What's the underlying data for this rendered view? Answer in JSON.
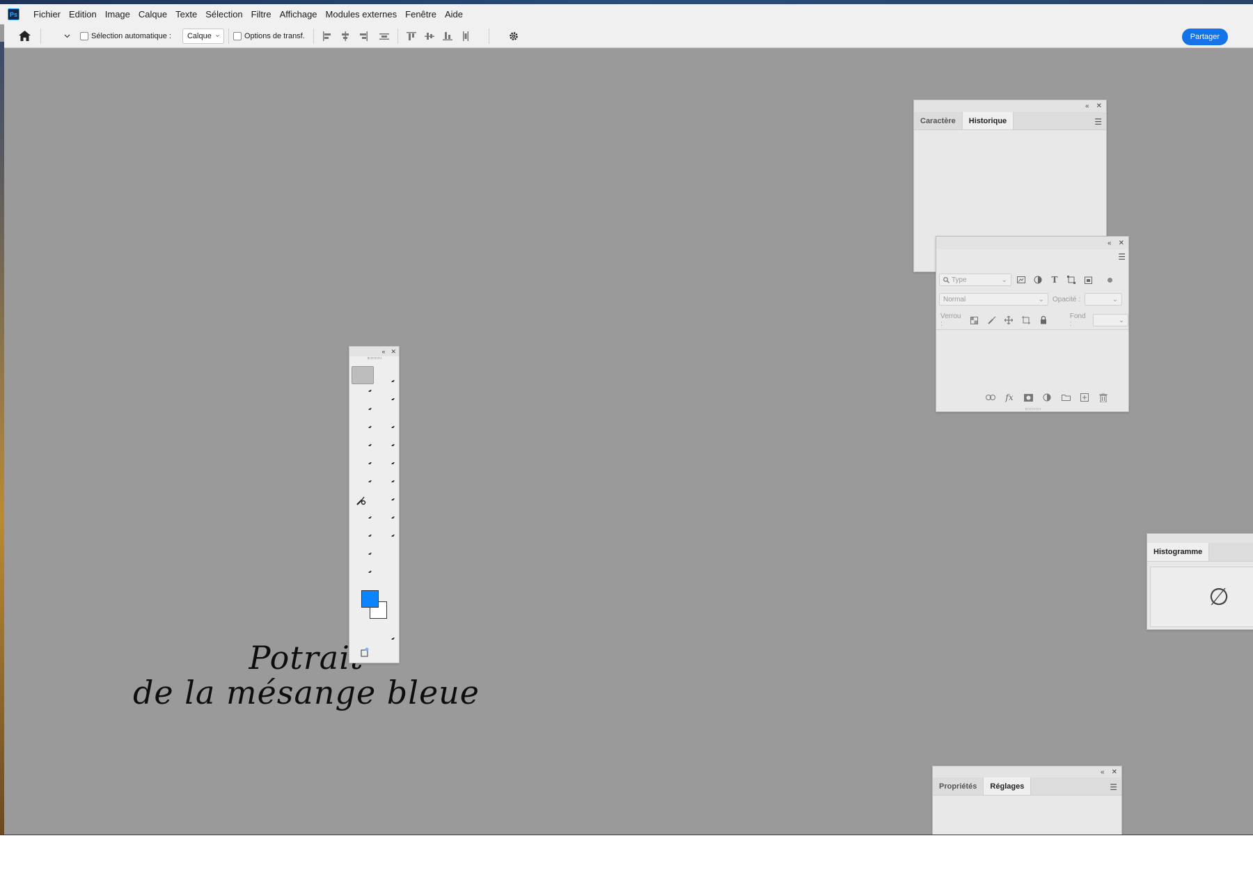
{
  "app": {
    "logo_text": "Ps",
    "accent": "#1473e6",
    "foreground_color": "#0a84ff",
    "background_color": "#ffffff"
  },
  "menubar": {
    "items": [
      "Fichier",
      "Edition",
      "Image",
      "Calque",
      "Texte",
      "Sélection",
      "Filtre",
      "Affichage",
      "Modules externes",
      "Fenêtre",
      "Aide"
    ]
  },
  "optionsbar": {
    "auto_select_label": "Sélection automatique :",
    "auto_select_value": "Calque",
    "transform_label": "Options de transf.",
    "share_label": "Partager"
  },
  "history_panel": {
    "tabs": [
      "Caractère",
      "Historique"
    ],
    "active_tab": "Historique"
  },
  "layers_panel": {
    "filter_placeholder": "Type",
    "blend_mode": "Normal",
    "opacity_label": "Opacité :",
    "lock_label": "Verrou :",
    "fill_label": "Fond :"
  },
  "histogram_panel": {
    "tab": "Histogramme",
    "empty_symbol": "∅"
  },
  "properties_panel": {
    "tabs": [
      "Propriétés",
      "Réglages"
    ],
    "active_tab": "Réglages"
  },
  "canvas": {
    "title_line1": "Potrait",
    "title_line2": "de la mésange bleue"
  }
}
